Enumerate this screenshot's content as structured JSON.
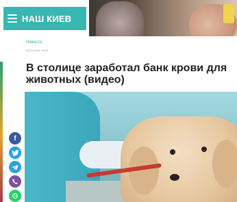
{
  "header": {
    "brand": "НАШ КИЕВ",
    "menu_icon": "hamburger-menu-icon",
    "background_color": "#38b7b1"
  },
  "article": {
    "category": "Новости",
    "date": "26.04.2018, 18:09",
    "title": "В столице заработал банк крови для животных (видео)"
  },
  "share": {
    "icons": [
      "facebook-icon",
      "twitter-icon",
      "telegram-icon",
      "viber-icon",
      "whatsapp-icon"
    ]
  },
  "colors": {
    "accent": "#38b7b1",
    "facebook": "#3b5998",
    "twitter": "#1da1f2",
    "telegram": "#2aa3df",
    "viber": "#7b519d",
    "whatsapp": "#25d366"
  }
}
